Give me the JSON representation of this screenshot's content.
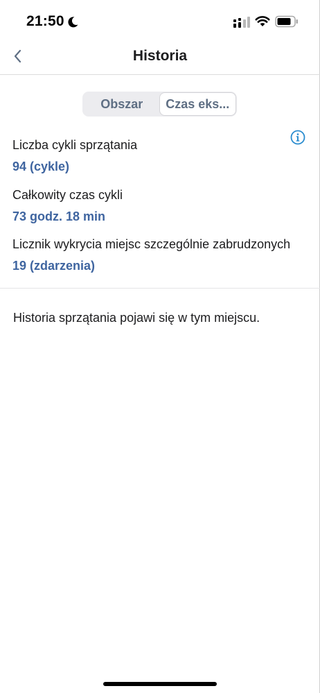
{
  "status_bar": {
    "time": "21:50"
  },
  "nav": {
    "title": "Historia"
  },
  "tabs": [
    {
      "label": "Obszar",
      "active": false
    },
    {
      "label": "Czas eks...",
      "active": true
    }
  ],
  "stats": [
    {
      "label": "Liczba cykli sprzątania",
      "value": "94 (cykle)"
    },
    {
      "label": "Całkowity czas cykli",
      "value": "73 godz. 18 min"
    },
    {
      "label": "Licznik wykrycia miejsc szczególnie zabrudzonych",
      "value": "19 (zdarzenia)"
    }
  ],
  "history": {
    "empty_message": "Historia sprzątania pojawi się w tym miejscu."
  },
  "colors": {
    "accent": "#3f65a0",
    "info_icon": "#2a8ccf",
    "segment_text": "#5f6f84"
  },
  "icons": {
    "back": "chevron-left-icon",
    "info": "info-circle-icon",
    "moon": "moon-icon",
    "signal": "cellular-signal-icon",
    "wifi": "wifi-icon",
    "battery": "battery-icon"
  }
}
